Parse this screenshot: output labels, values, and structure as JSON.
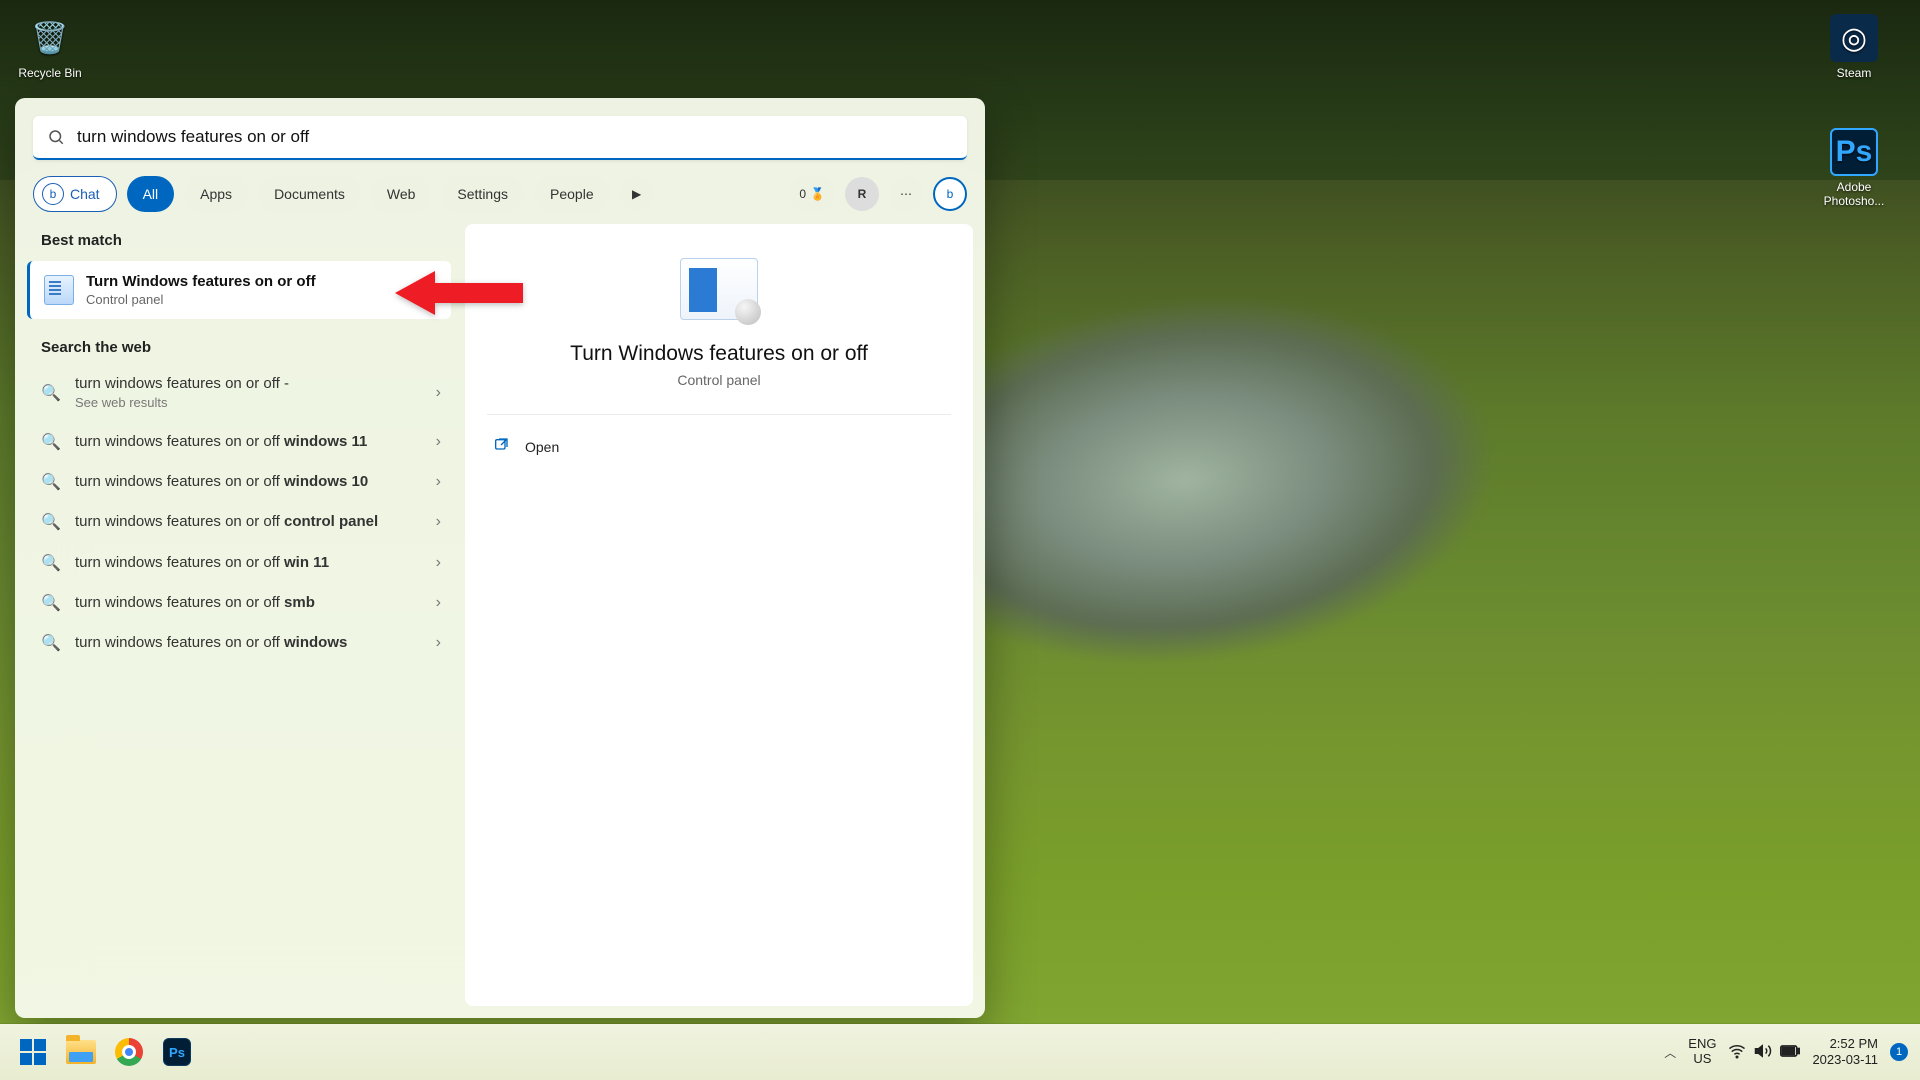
{
  "desktop_icons": {
    "recycle": "Recycle Bin",
    "steam": "Steam",
    "ps": "Adobe Photosho..."
  },
  "search": {
    "query": "turn windows features on or off"
  },
  "filters": {
    "chat": "Chat",
    "all": "All",
    "apps": "Apps",
    "documents": "Documents",
    "web": "Web",
    "settings": "Settings",
    "people": "People",
    "points": "0",
    "user_initial": "R"
  },
  "sections": {
    "best_match": "Best match",
    "search_web": "Search the web"
  },
  "best_match": {
    "title": "Turn Windows features on or off",
    "subtitle": "Control panel"
  },
  "web_results": [
    {
      "prefix": "turn windows features on or off - ",
      "bold": "",
      "sub": "See web results"
    },
    {
      "prefix": "turn windows features on or off ",
      "bold": "windows 11",
      "sub": ""
    },
    {
      "prefix": "turn windows features on or off ",
      "bold": "windows 10",
      "sub": ""
    },
    {
      "prefix": "turn windows features on or off ",
      "bold": "control panel",
      "sub": ""
    },
    {
      "prefix": "turn windows features on or off ",
      "bold": "win 11",
      "sub": ""
    },
    {
      "prefix": "turn windows features on or off ",
      "bold": "smb",
      "sub": ""
    },
    {
      "prefix": "turn windows features on or off ",
      "bold": "windows",
      "sub": ""
    }
  ],
  "preview": {
    "title": "Turn Windows features on or off",
    "subtitle": "Control panel",
    "open": "Open"
  },
  "taskbar": {
    "lang1": "ENG",
    "lang2": "US",
    "time": "2:52 PM",
    "date": "2023-03-11",
    "notif_count": "1"
  }
}
